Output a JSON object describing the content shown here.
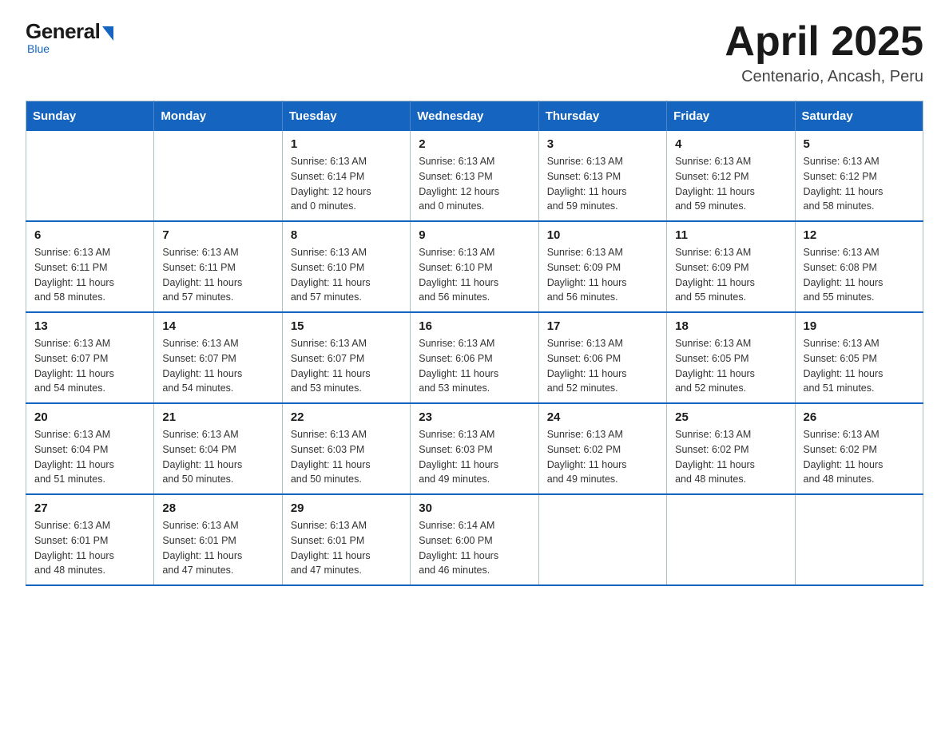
{
  "logo": {
    "general": "General",
    "blue": "Blue",
    "tagline": "Blue"
  },
  "header": {
    "title": "April 2025",
    "subtitle": "Centenario, Ancash, Peru"
  },
  "columns": [
    "Sunday",
    "Monday",
    "Tuesday",
    "Wednesday",
    "Thursday",
    "Friday",
    "Saturday"
  ],
  "weeks": [
    [
      {
        "day": "",
        "info": ""
      },
      {
        "day": "",
        "info": ""
      },
      {
        "day": "1",
        "info": "Sunrise: 6:13 AM\nSunset: 6:14 PM\nDaylight: 12 hours\nand 0 minutes."
      },
      {
        "day": "2",
        "info": "Sunrise: 6:13 AM\nSunset: 6:13 PM\nDaylight: 12 hours\nand 0 minutes."
      },
      {
        "day": "3",
        "info": "Sunrise: 6:13 AM\nSunset: 6:13 PM\nDaylight: 11 hours\nand 59 minutes."
      },
      {
        "day": "4",
        "info": "Sunrise: 6:13 AM\nSunset: 6:12 PM\nDaylight: 11 hours\nand 59 minutes."
      },
      {
        "day": "5",
        "info": "Sunrise: 6:13 AM\nSunset: 6:12 PM\nDaylight: 11 hours\nand 58 minutes."
      }
    ],
    [
      {
        "day": "6",
        "info": "Sunrise: 6:13 AM\nSunset: 6:11 PM\nDaylight: 11 hours\nand 58 minutes."
      },
      {
        "day": "7",
        "info": "Sunrise: 6:13 AM\nSunset: 6:11 PM\nDaylight: 11 hours\nand 57 minutes."
      },
      {
        "day": "8",
        "info": "Sunrise: 6:13 AM\nSunset: 6:10 PM\nDaylight: 11 hours\nand 57 minutes."
      },
      {
        "day": "9",
        "info": "Sunrise: 6:13 AM\nSunset: 6:10 PM\nDaylight: 11 hours\nand 56 minutes."
      },
      {
        "day": "10",
        "info": "Sunrise: 6:13 AM\nSunset: 6:09 PM\nDaylight: 11 hours\nand 56 minutes."
      },
      {
        "day": "11",
        "info": "Sunrise: 6:13 AM\nSunset: 6:09 PM\nDaylight: 11 hours\nand 55 minutes."
      },
      {
        "day": "12",
        "info": "Sunrise: 6:13 AM\nSunset: 6:08 PM\nDaylight: 11 hours\nand 55 minutes."
      }
    ],
    [
      {
        "day": "13",
        "info": "Sunrise: 6:13 AM\nSunset: 6:07 PM\nDaylight: 11 hours\nand 54 minutes."
      },
      {
        "day": "14",
        "info": "Sunrise: 6:13 AM\nSunset: 6:07 PM\nDaylight: 11 hours\nand 54 minutes."
      },
      {
        "day": "15",
        "info": "Sunrise: 6:13 AM\nSunset: 6:07 PM\nDaylight: 11 hours\nand 53 minutes."
      },
      {
        "day": "16",
        "info": "Sunrise: 6:13 AM\nSunset: 6:06 PM\nDaylight: 11 hours\nand 53 minutes."
      },
      {
        "day": "17",
        "info": "Sunrise: 6:13 AM\nSunset: 6:06 PM\nDaylight: 11 hours\nand 52 minutes."
      },
      {
        "day": "18",
        "info": "Sunrise: 6:13 AM\nSunset: 6:05 PM\nDaylight: 11 hours\nand 52 minutes."
      },
      {
        "day": "19",
        "info": "Sunrise: 6:13 AM\nSunset: 6:05 PM\nDaylight: 11 hours\nand 51 minutes."
      }
    ],
    [
      {
        "day": "20",
        "info": "Sunrise: 6:13 AM\nSunset: 6:04 PM\nDaylight: 11 hours\nand 51 minutes."
      },
      {
        "day": "21",
        "info": "Sunrise: 6:13 AM\nSunset: 6:04 PM\nDaylight: 11 hours\nand 50 minutes."
      },
      {
        "day": "22",
        "info": "Sunrise: 6:13 AM\nSunset: 6:03 PM\nDaylight: 11 hours\nand 50 minutes."
      },
      {
        "day": "23",
        "info": "Sunrise: 6:13 AM\nSunset: 6:03 PM\nDaylight: 11 hours\nand 49 minutes."
      },
      {
        "day": "24",
        "info": "Sunrise: 6:13 AM\nSunset: 6:02 PM\nDaylight: 11 hours\nand 49 minutes."
      },
      {
        "day": "25",
        "info": "Sunrise: 6:13 AM\nSunset: 6:02 PM\nDaylight: 11 hours\nand 48 minutes."
      },
      {
        "day": "26",
        "info": "Sunrise: 6:13 AM\nSunset: 6:02 PM\nDaylight: 11 hours\nand 48 minutes."
      }
    ],
    [
      {
        "day": "27",
        "info": "Sunrise: 6:13 AM\nSunset: 6:01 PM\nDaylight: 11 hours\nand 48 minutes."
      },
      {
        "day": "28",
        "info": "Sunrise: 6:13 AM\nSunset: 6:01 PM\nDaylight: 11 hours\nand 47 minutes."
      },
      {
        "day": "29",
        "info": "Sunrise: 6:13 AM\nSunset: 6:01 PM\nDaylight: 11 hours\nand 47 minutes."
      },
      {
        "day": "30",
        "info": "Sunrise: 6:14 AM\nSunset: 6:00 PM\nDaylight: 11 hours\nand 46 minutes."
      },
      {
        "day": "",
        "info": ""
      },
      {
        "day": "",
        "info": ""
      },
      {
        "day": "",
        "info": ""
      }
    ]
  ]
}
